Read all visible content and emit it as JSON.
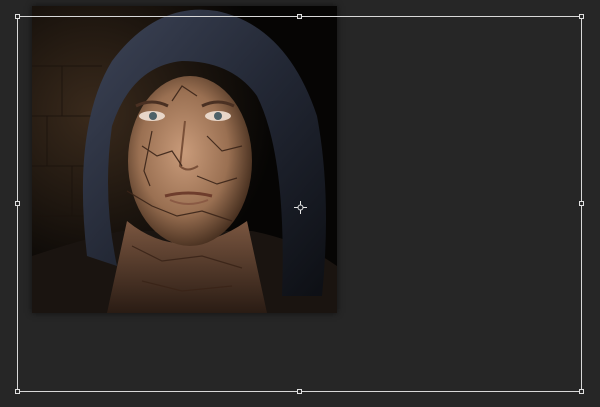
{
  "canvas": {
    "background": "#262626"
  },
  "layer": {
    "subject": "hooded-man-cracked-face",
    "hood_color": "#2c3140",
    "skin_color": "#b98f70"
  },
  "transform": {
    "mode": "free-transform",
    "handle_color": "#e0e0e0",
    "border_color": "#d8d8d8",
    "pivot_icon": "reference-point-crosshair-icon"
  }
}
